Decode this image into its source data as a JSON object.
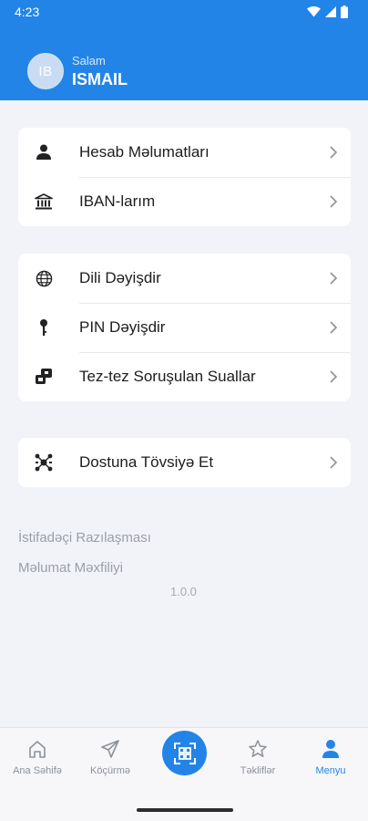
{
  "status": {
    "time": "4:23"
  },
  "user": {
    "initials": "IB",
    "greeting": "Salam",
    "name": "ISMAIL"
  },
  "menu": {
    "group1": [
      {
        "label": "Hesab Məlumatları",
        "icon": "person-icon"
      },
      {
        "label": "IBAN-larım",
        "icon": "bank-icon"
      }
    ],
    "group2": [
      {
        "label": "Dili Dəyişdir",
        "icon": "globe-icon"
      },
      {
        "label": "PIN Dəyişdir",
        "icon": "key-icon"
      },
      {
        "label": "Tez-tez Soruşulan Suallar",
        "icon": "faq-icon"
      }
    ],
    "group3": [
      {
        "label": "Dostuna Tövsiyə Et",
        "icon": "share-icon"
      }
    ]
  },
  "links": {
    "agreement": "İstifadəçi Razılaşması",
    "privacy": "Məlumat Məxfiliyi",
    "version": "1.0.0"
  },
  "nav": {
    "home": "Ana Səhifə",
    "transfer": "Köçürmə",
    "offers": "Təkliflər",
    "menu": "Menyu",
    "scan_icon": "qr-scan-icon"
  },
  "colors": {
    "primary": "#2384e8",
    "background": "#f2f3f8",
    "muted": "#9aa0a8"
  }
}
